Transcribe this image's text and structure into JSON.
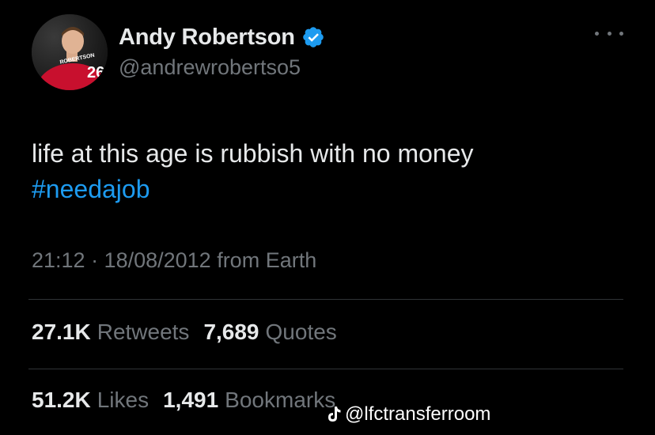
{
  "user": {
    "display_name": "Andy Robertson",
    "handle": "@andrewrobertso5",
    "avatar_jersey_number": "26",
    "avatar_jersey_name": "ROBERTSON",
    "verified": true
  },
  "tweet": {
    "text_line1": "life at this age is rubbish with no money",
    "hashtag": "#needajob",
    "meta": "21:12 · 18/08/2012 from Earth"
  },
  "stats": {
    "retweets_count": "27.1K",
    "retweets_label": "Retweets",
    "quotes_count": "7,689",
    "quotes_label": "Quotes",
    "likes_count": "51.2K",
    "likes_label": "Likes",
    "bookmarks_count": "1,491",
    "bookmarks_label": "Bookmarks"
  },
  "watermark": {
    "icon": "tiktok-icon",
    "text": "@lfctransferroom"
  },
  "colors": {
    "background": "#000000",
    "text_primary": "#e7e9ea",
    "text_secondary": "#71767b",
    "link": "#1d9bf0",
    "divider": "#2f3336"
  }
}
